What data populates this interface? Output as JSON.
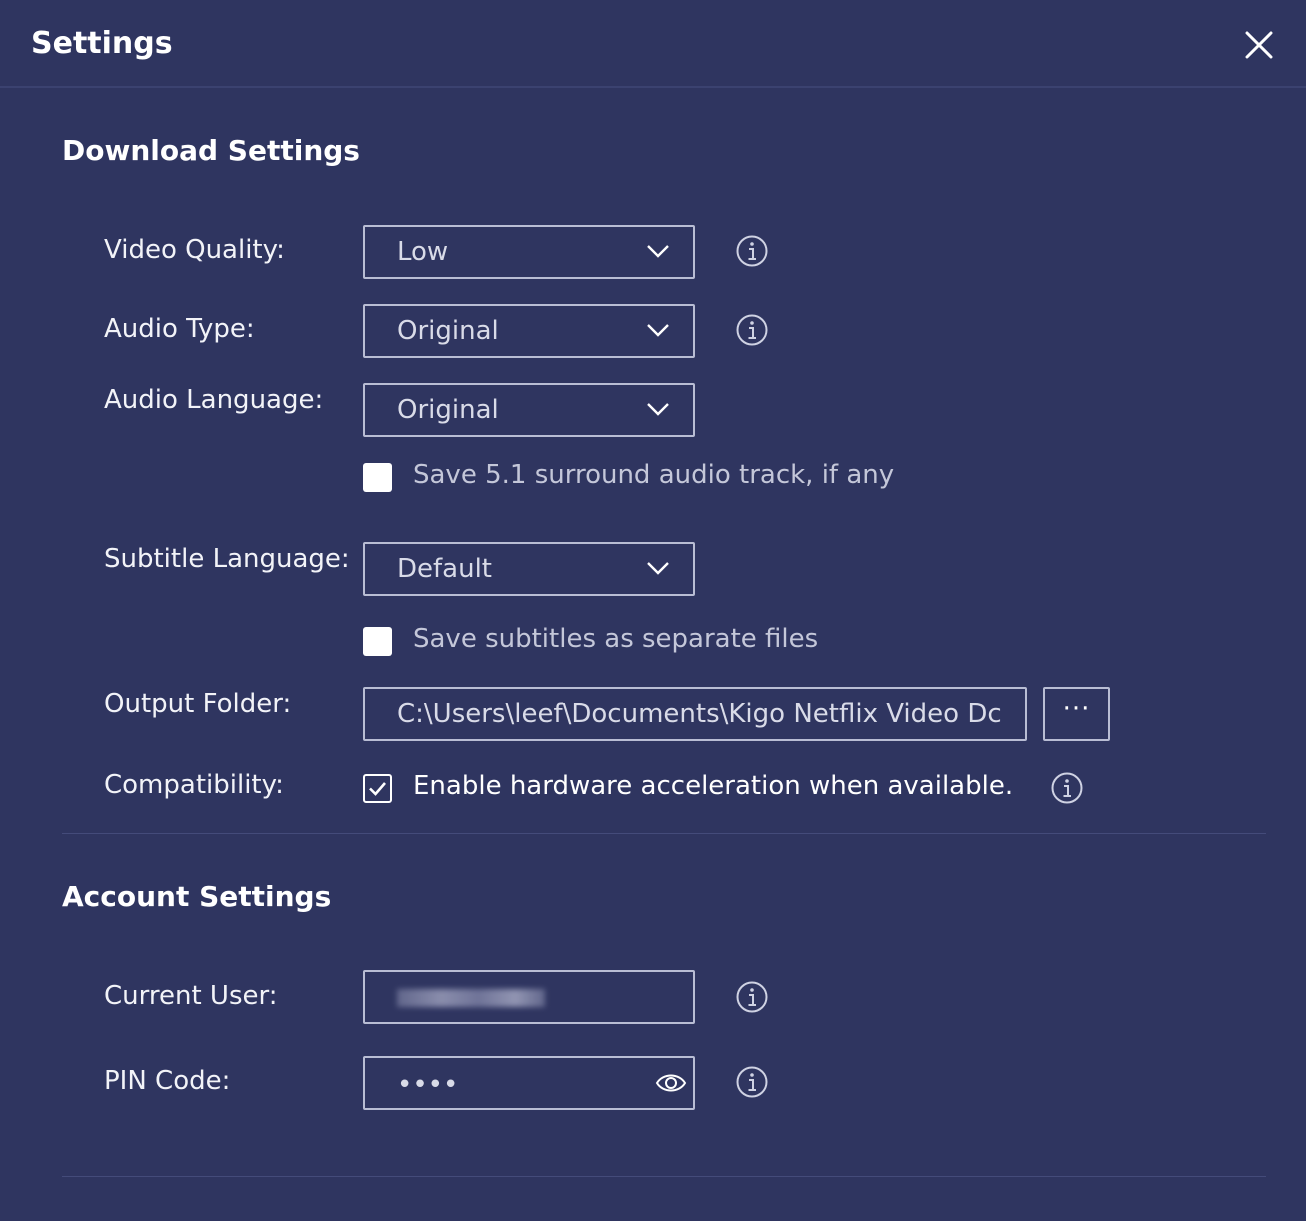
{
  "window": {
    "title": "Settings"
  },
  "download": {
    "section_title": "Download Settings",
    "video_quality": {
      "label": "Video Quality:",
      "value": "Low"
    },
    "audio_type": {
      "label": "Audio Type:",
      "value": "Original"
    },
    "audio_language": {
      "label": "Audio Language:",
      "value": "Original"
    },
    "surround": {
      "label": "Save 5.1 surround audio track, if any",
      "checked": false
    },
    "subtitle_language": {
      "label": "Subtitle Language:",
      "value": "Default"
    },
    "separate_subtitles": {
      "label": "Save subtitles as separate files",
      "checked": false
    },
    "output_folder": {
      "label": "Output Folder:",
      "value": "C:\\Users\\leef\\Documents\\Kigo Netflix Video Dc",
      "browse_label": "···"
    },
    "compatibility": {
      "label": "Compatibility:",
      "option_label": "Enable hardware acceleration when available.",
      "checked": true
    }
  },
  "account": {
    "section_title": "Account Settings",
    "current_user": {
      "label": "Current User:"
    },
    "pin_code": {
      "label": "PIN Code:",
      "value": "••••"
    }
  },
  "colors": {
    "background": "#2f3560",
    "border": "#b9bdd4",
    "divider": "#444b7a"
  },
  "icons": [
    "close-icon",
    "chevron-down-icon",
    "info-icon",
    "checkmark-icon",
    "eye-icon",
    "more-icon"
  ]
}
